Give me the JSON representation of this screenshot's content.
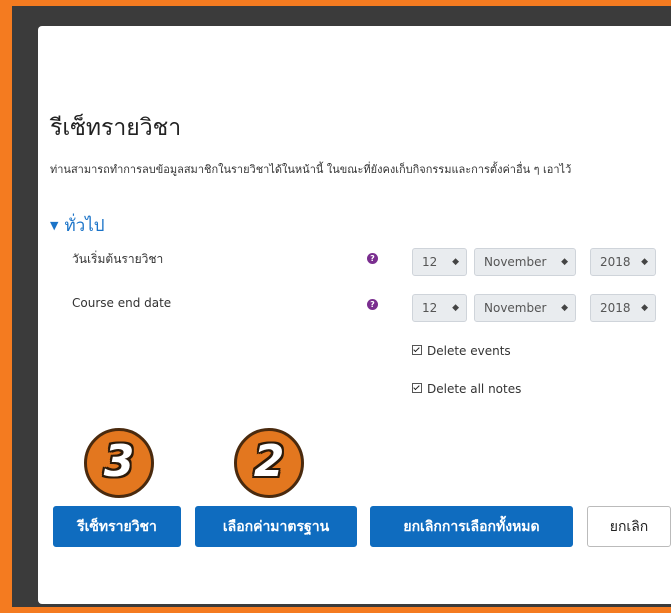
{
  "page_title": "รีเซ็ทรายวิชา",
  "description": "ท่านสามารถทำการลบข้อมูลสมาชิกในรายวิชาได้ในหน้านี้ ในขณะที่ยังคงเก็บกิจกรรมและการตั้งค่าอื่น ๆ เอาไว้",
  "section": {
    "chevron": "▼",
    "title": "ทั่วไป"
  },
  "fields": {
    "start": {
      "label": "วันเริ่มต้นรายวิชา",
      "help": "?",
      "day": "12",
      "month": "November",
      "year": "2018"
    },
    "end": {
      "label": "Course end date",
      "help": "?",
      "day": "12",
      "month": "November",
      "year": "2018"
    }
  },
  "checkboxes": {
    "delete_events": {
      "label": "Delete events",
      "checked": true
    },
    "delete_notes": {
      "label": "Delete all notes",
      "checked": true
    }
  },
  "buttons": {
    "reset": "รีเซ็ทรายวิชา",
    "select_default": "เลือกค่ามาตรฐาน",
    "deselect_all": "ยกเลิกการเลือกทั้งหมด",
    "cancel": "ยกเลิก"
  },
  "annotations": {
    "step_3": "3",
    "step_2": "2"
  },
  "colors": {
    "accent": "#0f6cbf",
    "link": "#1a73c8",
    "border_orange": "#f47b20",
    "help_icon": "#7a2e8f"
  }
}
